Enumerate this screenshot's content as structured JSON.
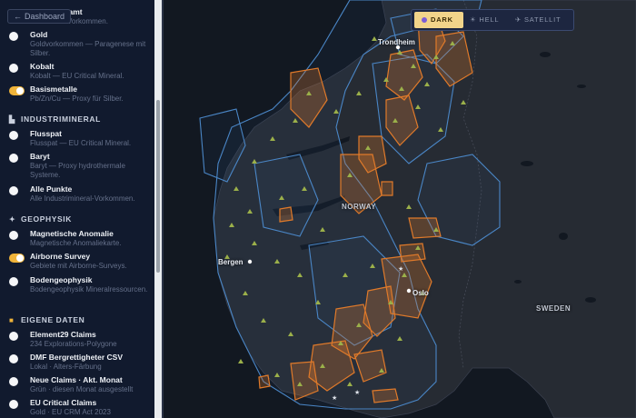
{
  "sidebar": {
    "dashboard_label": "Dashboard",
    "top_item": {
      "title": "… gesamt",
      "desc": "… GE Vorkommen."
    },
    "items": [
      {
        "title": "Gold",
        "desc": "Goldvorkommen — Paragenese mit Silber."
      },
      {
        "title": "Kobalt",
        "desc": "Kobalt — EU Critical Mineral."
      },
      {
        "title": "Basismetalle",
        "desc": "Pb/Zn/Cu — Proxy für Silber."
      }
    ],
    "section_industrie": "INDUSTRIMINERAL",
    "industrie_items": [
      {
        "title": "Flusspat",
        "desc": "Flusspat — EU Critical Mineral."
      },
      {
        "title": "Baryt",
        "desc": "Baryt — Proxy hydrothermale Systeme."
      },
      {
        "title": "Alle Punkte",
        "desc": "Alle Industrimineral-Vorkommen."
      }
    ],
    "section_geophysik": "GEOPHYSIK",
    "geophysik_items": [
      {
        "title": "Magnetische Anomalie",
        "desc": "Magnetische Anomaliekarte."
      },
      {
        "title": "Airborne Survey",
        "desc": "Gebiete mit Airborne-Surveys."
      },
      {
        "title": "Bodengeophysik",
        "desc": "Bodengeophysik Mineralressourcen."
      }
    ],
    "section_eigene": "EIGENE DATEN",
    "eigene_items": [
      {
        "title": "Element29 Claims",
        "desc": "234 Explorations-Polygone"
      },
      {
        "title": "DMF Bergrettigheter CSV",
        "desc": "Lokal · Alters-Färbung"
      },
      {
        "title": "Neue Claims · Akt. Monat",
        "desc": "Grün · diesen Monat ausgestellt"
      },
      {
        "title": "EU Critical Claims",
        "desc": "Gold · EU CRM Act 2023"
      }
    ]
  },
  "map": {
    "style_options": {
      "dark": "DARK",
      "hell": "HELL",
      "satellit": "SATELLIT"
    },
    "labels": {
      "trondheim": "Trondheim",
      "norway": "NORWAY",
      "bergen": "Bergen",
      "oslo": "Oslo",
      "sweden": "SWEDEN"
    }
  },
  "colors": {
    "accent": "#f0b43a",
    "claim_outline": "#e07a2a",
    "region_outline": "#3f7fc0",
    "marker": "#9bb04a"
  }
}
